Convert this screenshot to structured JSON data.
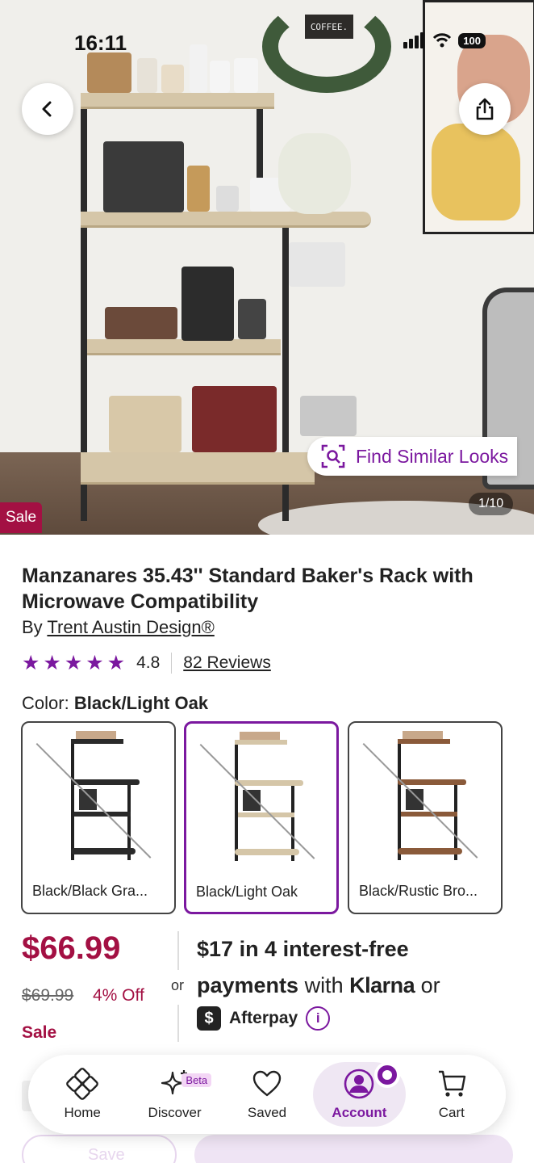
{
  "status_bar": {
    "time": "16:11",
    "battery": "100"
  },
  "hero": {
    "sign_text": "COFFEE.",
    "find_similar_label": "Find Similar Looks",
    "sale_badge": "Sale",
    "image_counter": "1/10"
  },
  "product": {
    "title": "Manzanares 35.43'' Standard Baker's Rack with Microwave Compatibility",
    "by_prefix": "By",
    "brand": "Trent Austin Design®",
    "rating": "4.8",
    "reviews": "82 Reviews",
    "color_prefix": "Color:",
    "selected_color": "Black/Light Oak",
    "swatches": [
      {
        "label": "Black/Black Gra...",
        "shelf_color": "#2a2a2a"
      },
      {
        "label": "Black/Light Oak",
        "shelf_color": "#d5c6a8"
      },
      {
        "label": "Black/Rustic Bro...",
        "shelf_color": "#8a5a3a"
      }
    ]
  },
  "pricing": {
    "price": "$66.99",
    "old_price": "$69.99",
    "percent_off": "4% Off",
    "sale_label": "Sale",
    "or_label": "or",
    "klarna_amount": "$17",
    "klarna_line1_rest": " in 4 interest-free",
    "klarna_line2_a": "payments",
    "klarna_line2_b": " with ",
    "klarna_brand": "Klarna",
    "klarna_line2_c": " or",
    "afterpay_label": "Afterpay",
    "info_icon_text": "i"
  },
  "behind_nav": {
    "save_label": "Save"
  },
  "bottom_nav": {
    "items": [
      {
        "label": "Home"
      },
      {
        "label": "Discover",
        "badge": "Beta"
      },
      {
        "label": "Saved"
      },
      {
        "label": "Account"
      },
      {
        "label": "Cart"
      }
    ],
    "active": "Account"
  },
  "colors": {
    "brand_purple": "#7b189f",
    "sale_red": "#a31043"
  }
}
